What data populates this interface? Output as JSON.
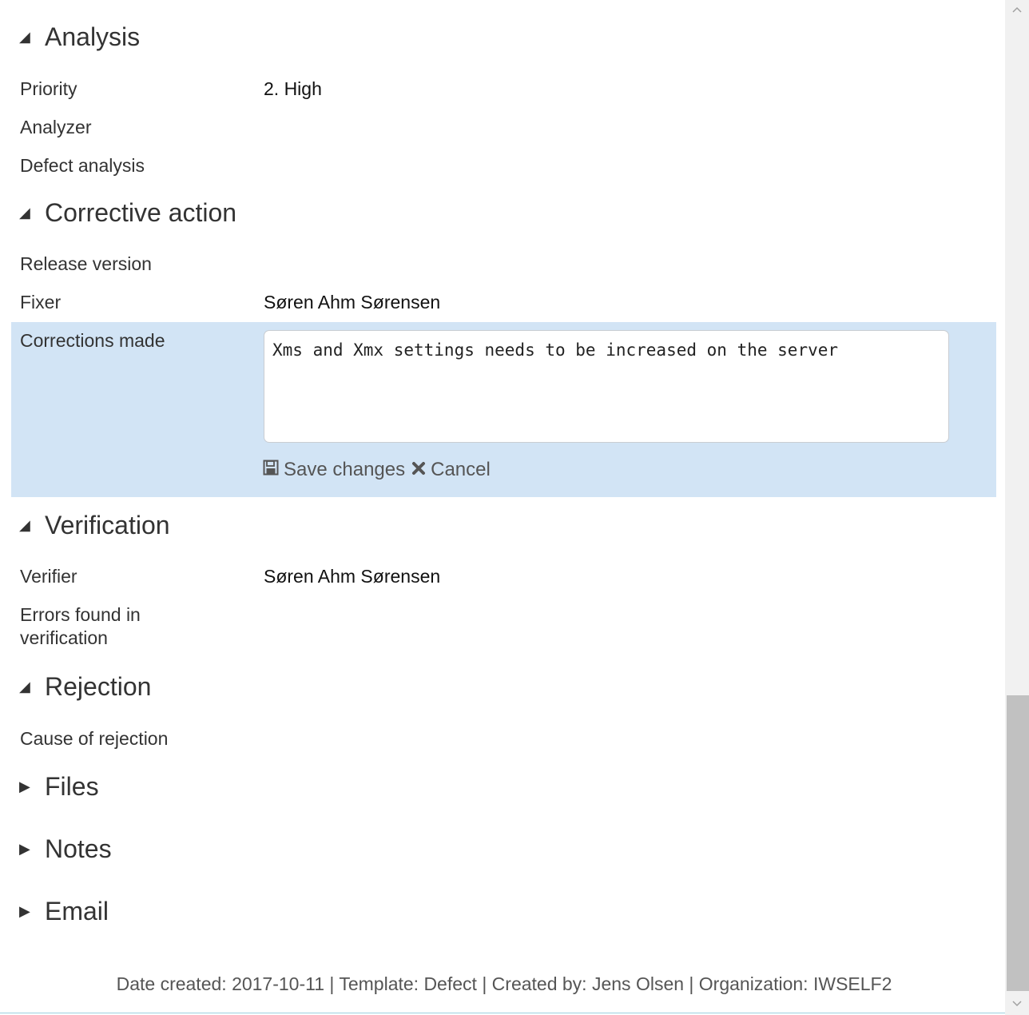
{
  "sections": {
    "analysis": {
      "title": "Analysis",
      "fields": {
        "priority_label": "Priority",
        "priority_value": "2. High",
        "analyzer_label": "Analyzer",
        "defect_analysis_label": "Defect analysis"
      }
    },
    "corrective_action": {
      "title": "Corrective action",
      "fields": {
        "release_version_label": "Release version",
        "fixer_label": "Fixer",
        "fixer_value": "Søren Ahm Sørensen",
        "corrections_made_label": "Corrections made",
        "corrections_made_value": "Xms and Xmx settings needs to be increased on the server"
      },
      "actions": {
        "save_label": "Save changes",
        "cancel_label": "Cancel"
      }
    },
    "verification": {
      "title": "Verification",
      "fields": {
        "verifier_label": "Verifier",
        "verifier_value": "Søren Ahm Sørensen",
        "errors_found_label_line1": "Errors found in",
        "errors_found_label_line2": "verification"
      }
    },
    "rejection": {
      "title": "Rejection",
      "fields": {
        "cause_label": "Cause of rejection"
      }
    },
    "files": {
      "title": "Files"
    },
    "notes": {
      "title": "Notes"
    },
    "email": {
      "title": "Email"
    }
  },
  "footer": {
    "text": "Date created: 2017-10-11 | Template: Defect | Created by: Jens Olsen | Organization: IWSELF2"
  },
  "colors": {
    "edit_row_bg": "#d2e4f5",
    "bottom_line": "#9ccfe0"
  },
  "icons": {
    "expanded": "triangle-expanded-icon",
    "collapsed": "triangle-collapsed-icon",
    "save": "floppy-disk-icon",
    "cancel": "close-x-icon"
  }
}
